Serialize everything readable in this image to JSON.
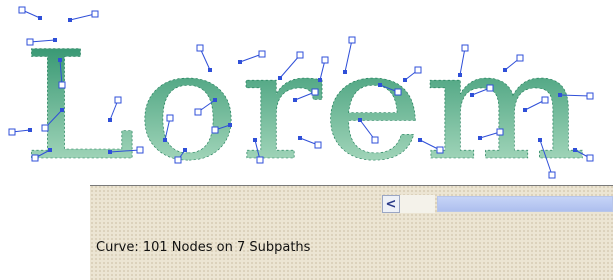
{
  "artwork": {
    "text": "Lorem",
    "fill_top": "#1f8a63",
    "fill_bottom": "#bfe6cd",
    "node_color": "#2f4fd8"
  },
  "scrollbar": {
    "left_arrow_icon": "chevron-left-icon",
    "left_arrow_glyph": "<"
  },
  "status_bar": {
    "text": "Curve: 101 Nodes on 7 Subpaths"
  }
}
